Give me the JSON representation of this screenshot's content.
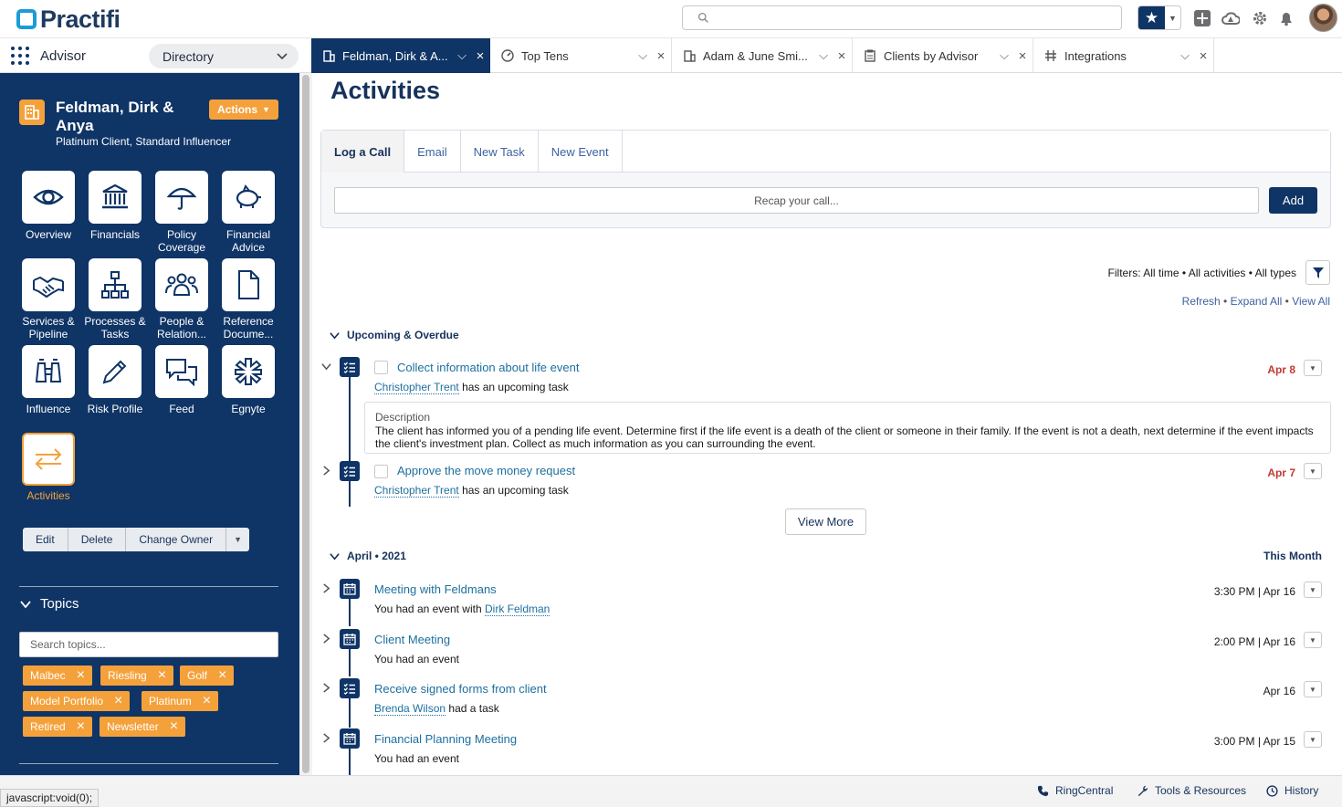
{
  "brand": {
    "name": "Practifi",
    "color": "#1b9bd7"
  },
  "search": {
    "placeholder": ""
  },
  "nav": {
    "app_name": "Advisor",
    "directory_label": "Directory",
    "tabs": [
      {
        "label": "Feldman, Dirk & A...",
        "icon": "building-icon",
        "active": true
      },
      {
        "label": "Top Tens",
        "icon": "gauge-icon",
        "active": false
      },
      {
        "label": "Adam & June Smi...",
        "icon": "building-icon",
        "active": false
      },
      {
        "label": "Clients by Advisor",
        "icon": "report-icon",
        "active": false
      },
      {
        "label": "Integrations",
        "icon": "integration-icon",
        "active": false
      }
    ]
  },
  "record": {
    "name": "Feldman, Dirk & Anya",
    "subtitle": "Platinum Client, Standard Influencer",
    "actions_label": "Actions",
    "tiles": [
      {
        "label": "Overview",
        "icon": "eye-icon"
      },
      {
        "label": "Financials",
        "icon": "bank-icon"
      },
      {
        "label": "Policy Coverage",
        "icon": "umbrella-icon"
      },
      {
        "label": "Financial Advice",
        "icon": "piggy-bank-icon"
      },
      {
        "label": "Services & Pipeline",
        "icon": "handshake-icon"
      },
      {
        "label": "Processes & Tasks",
        "icon": "hierarchy-icon"
      },
      {
        "label": "People & Relation...",
        "icon": "people-icon"
      },
      {
        "label": "Reference Docume...",
        "icon": "document-icon"
      },
      {
        "label": "Influence",
        "icon": "binoculars-icon"
      },
      {
        "label": "Risk Profile",
        "icon": "pencil-icon"
      },
      {
        "label": "Feed",
        "icon": "chat-icon"
      },
      {
        "label": "Egnyte",
        "icon": "egnyte-icon"
      },
      {
        "label": "Activities",
        "icon": "swap-arrows-icon",
        "selected": true
      }
    ],
    "buttons": [
      "Edit",
      "Delete",
      "Change Owner"
    ]
  },
  "topics": {
    "heading": "Topics",
    "search_placeholder": "Search topics...",
    "pills": [
      "Malbec",
      "Riesling",
      "Golf",
      "Model Portfolio",
      "Platinum",
      "Retired",
      "Newsletter"
    ]
  },
  "activities": {
    "title": "Activities",
    "composer_tabs": [
      "Log a Call",
      "Email",
      "New Task",
      "New Event"
    ],
    "recap_placeholder": "Recap your call...",
    "add_label": "Add",
    "filters_text": "Filters: All time • All activities • All types",
    "links": [
      "Refresh",
      "Expand All",
      "View All"
    ],
    "upcoming": {
      "heading": "Upcoming & Overdue",
      "items": [
        {
          "title": "Collect information about life event",
          "person": "Christopher Trent",
          "suffix": "has an upcoming task",
          "date": "Apr 8"
        },
        {
          "title": "Approve the move money request",
          "person": "Christopher Trent",
          "suffix": "has an upcoming task",
          "date": "Apr 7"
        }
      ],
      "description_label": "Description",
      "description": "The client has informed you of a pending life event. Determine first if the life event is a death of the client or someone in their family. If the event is not a death, next determine if the event impacts the client's investment plan. Collect as much information as you can surrounding the event.",
      "view_more": "View More"
    },
    "month": {
      "heading": "April • 2021",
      "badge": "This Month",
      "items": [
        {
          "title": "Meeting with Feldmans",
          "prefix": "You had an event with",
          "person": "Dirk Feldman",
          "date": "3:30 PM | Apr 16",
          "type": "event"
        },
        {
          "title": "Client Meeting",
          "prefix": "You had an event",
          "person": "",
          "date": "2:00 PM | Apr 16",
          "type": "event"
        },
        {
          "title": "Receive signed forms from client",
          "person": "Brenda Wilson",
          "suffix": "had a task",
          "date": "Apr 16",
          "type": "task"
        },
        {
          "title": "Financial Planning Meeting",
          "prefix": "You had an event",
          "person": "",
          "date": "3:00 PM | Apr 15",
          "type": "event"
        }
      ]
    }
  },
  "footer": {
    "status": "javascript:void(0);",
    "utilities": [
      "RingCentral",
      "Tools & Resources",
      "History"
    ]
  },
  "colors": {
    "navy": "#0f3466",
    "accent": "#f4a13b",
    "link": "#1d6f9f",
    "overdue": "#c23934"
  }
}
